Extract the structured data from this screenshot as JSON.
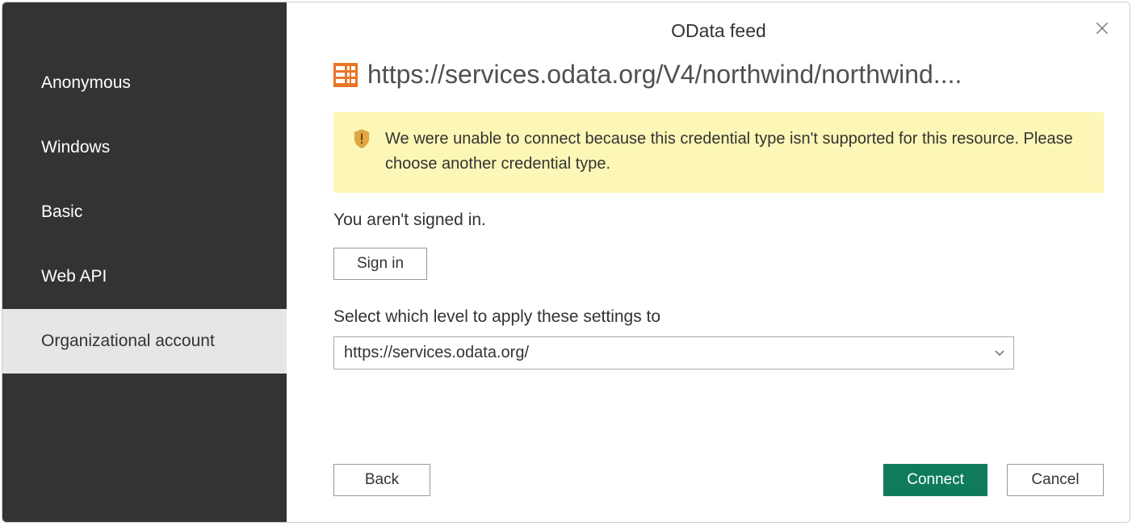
{
  "header": {
    "title": "OData feed"
  },
  "sidebar": {
    "items": [
      {
        "label": "Anonymous"
      },
      {
        "label": "Windows"
      },
      {
        "label": "Basic"
      },
      {
        "label": "Web API"
      },
      {
        "label": "Organizational account"
      }
    ],
    "selected_index": 4
  },
  "main": {
    "url": "https://services.odata.org/V4/northwind/northwind....",
    "warning": "We were unable to connect because this credential type isn't supported for this resource. Please choose another credential type.",
    "signin_status": "You aren't signed in.",
    "signin_button": "Sign in",
    "level_label": "Select which level to apply these settings to",
    "level_value": "https://services.odata.org/"
  },
  "footer": {
    "back": "Back",
    "connect": "Connect",
    "cancel": "Cancel"
  },
  "colors": {
    "sidebar_bg": "#333333",
    "warning_bg": "#fcf7b6",
    "primary": "#0f7b5c"
  }
}
